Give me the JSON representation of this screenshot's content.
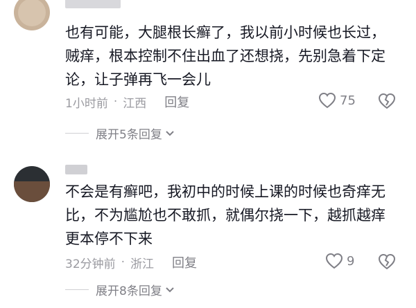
{
  "comments": [
    {
      "text": "也有可能，大腿根长癣了，我以前小时候也长过，贼痒，根本控制不住出血了还想挠，先别急着下定论，让子弹再飞一会儿",
      "time": "1小时前",
      "location": "江西",
      "reply_label": "回复",
      "likes": "75",
      "expand_label": "展开5条回复"
    },
    {
      "text": "不会是有癣吧，我初中的时候上课的时候也奇痒无比，不为尴尬也不敢抓，就偶尔挠一下，越抓越痒更本停不下来",
      "time": "32分钟前",
      "location": "浙江",
      "reply_label": "回复",
      "likes": "9",
      "expand_label": "展开8条回复"
    }
  ],
  "colors": {
    "text": "#161823",
    "meta": "#9a9aa0",
    "icon": "#7f7f86"
  },
  "icons": {
    "like": "heart-outline-icon",
    "dislike": "broken-heart-outline-icon",
    "expand": "chevron-down-icon"
  }
}
